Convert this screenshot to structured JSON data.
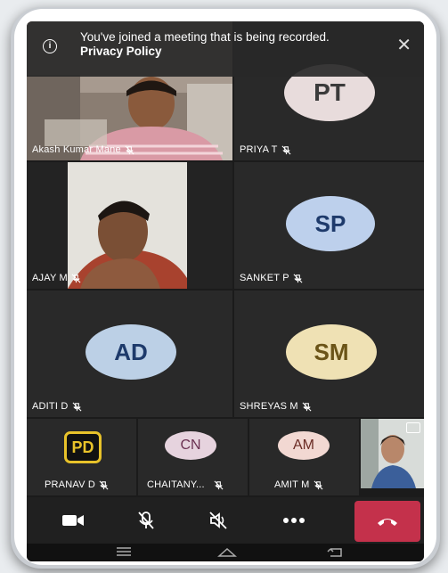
{
  "banner": {
    "message": "You've joined a meeting that is being recorded.",
    "link": "Privacy Policy",
    "info_icon": "info-icon",
    "close_icon": "close-icon"
  },
  "participants": [
    {
      "name": "Akash Kumar Mane",
      "muted": true,
      "video": true
    },
    {
      "name": "PRIYA T",
      "initials": "PT",
      "muted": true,
      "avatar_color": "#e8dcdc",
      "text_color": "#3b3b3b"
    },
    {
      "name": "AJAY M",
      "muted": true,
      "video": true
    },
    {
      "name": "SANKET P",
      "initials": "SP",
      "muted": true,
      "avatar_color": "#bdd0ec",
      "text_color": "#1e3a6b"
    },
    {
      "name": "ADITI D",
      "initials": "AD",
      "muted": true,
      "avatar_color": "#bcd0e6",
      "text_color": "#1e3a6b"
    },
    {
      "name": "SHREYAS M",
      "initials": "SM",
      "muted": true,
      "avatar_color": "#efe1b4",
      "text_color": "#6b5418"
    },
    {
      "name": "PRANAV D",
      "initials": "PD",
      "muted": true,
      "logo": true
    },
    {
      "name": "CHAITANY...",
      "initials": "CN",
      "muted": true,
      "avatar_color": "#e6d3de",
      "text_color": "#6b3152"
    },
    {
      "name": "AMIT M",
      "initials": "AM",
      "muted": true,
      "avatar_color": "#f2d8d2",
      "text_color": "#6b2b24"
    },
    {
      "name": "",
      "video": true,
      "self": true
    }
  ],
  "controls": {
    "camera": "video-camera-icon",
    "mic": "mic-off-icon",
    "speaker": "speaker-off-icon",
    "more": "more-icon",
    "hangup": "hang-up-icon",
    "hangup_color": "#c4314b"
  },
  "navbar": {
    "items": [
      "menu-icon",
      "home-icon",
      "back-icon"
    ]
  }
}
